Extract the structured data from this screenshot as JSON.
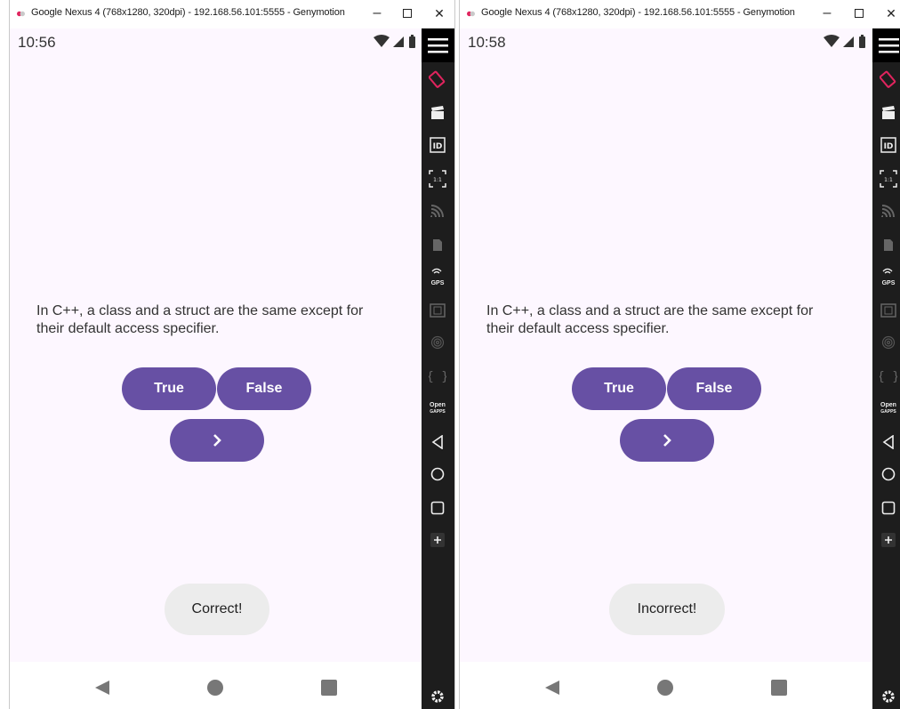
{
  "windows": [
    {
      "title": "Google Nexus 4 (768x1280, 320dpi) - 192.168.56.101:5555 - Genymotion",
      "time": "10:56",
      "question": "In C++, a class and a struct are the same except for their default access specifier.",
      "true_label": "True",
      "false_label": "False",
      "next_label": "›",
      "toast": "Correct!"
    },
    {
      "title": "Google Nexus 4 (768x1280, 320dpi) - 192.168.56.101:5555 - Genymotion",
      "time": "10:58",
      "question": "In C++, a class and a struct are the same except for their default access specifier.",
      "true_label": "True",
      "false_label": "False",
      "next_label": "›",
      "toast": "Incorrect!"
    }
  ],
  "window_controls": {
    "minimize": "–",
    "close": "✕"
  },
  "toolbar": {
    "gps_label": "GPS",
    "open_label": "Open",
    "gapps_label": "GAPPS"
  },
  "colors": {
    "primary": "#6750a4",
    "screen_bg": "#fdf7ff",
    "toast_bg": "#ececec",
    "toolbar_bg": "#1d1d1d",
    "rotate_accent": "#e0245e"
  }
}
